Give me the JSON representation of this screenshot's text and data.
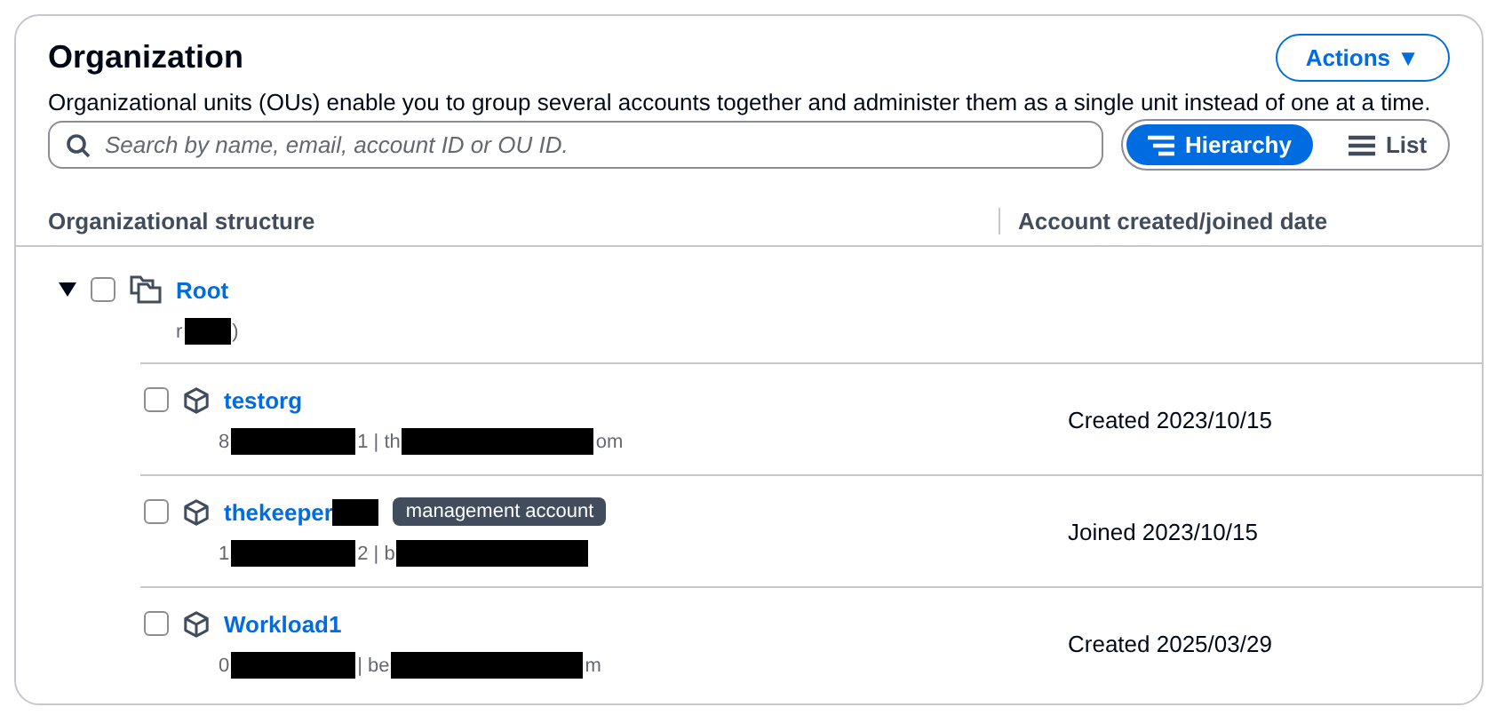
{
  "header": {
    "title": "Organization",
    "actions_button": "Actions ▼",
    "description": "Organizational units (OUs) enable you to group several accounts together and administer them as a single unit instead of one at a time."
  },
  "search": {
    "placeholder": "Search by name, email, account ID or OU ID."
  },
  "view_toggle": [
    {
      "label": "Hierarchy",
      "kind": "hierarchy",
      "selected": true
    },
    {
      "label": "List",
      "kind": "list",
      "selected": false
    }
  ],
  "table": {
    "columns": [
      "Organizational structure",
      "Account created/joined date"
    ],
    "tree": [
      {
        "name": "Root",
        "kind": "root",
        "expanded": true,
        "checked": false,
        "details": [
          {
            "kind": "text",
            "text": "r"
          },
          {
            "kind": "redacted"
          },
          {
            "kind": "text",
            "text": ")"
          }
        ],
        "children": [
          {
            "name": "testorg",
            "kind": "account",
            "checked": false,
            "date": "Created 2023/10/15",
            "details": [
              {
                "kind": "text",
                "text": "8"
              },
              {
                "kind": "redacted"
              },
              {
                "kind": "text",
                "text": "1 | th"
              },
              {
                "kind": "redacted"
              },
              {
                "kind": "text",
                "text": "om"
              }
            ]
          },
          {
            "name": "thekeeper",
            "kind": "account",
            "checked": false,
            "name_redacted": true,
            "badge": "management account",
            "date": "Joined 2023/10/15",
            "details": [
              {
                "kind": "text",
                "text": "1"
              },
              {
                "kind": "redacted"
              },
              {
                "kind": "text",
                "text": "2 | b"
              },
              {
                "kind": "redacted"
              }
            ]
          },
          {
            "name": "Workload1",
            "kind": "account",
            "checked": false,
            "date": "Created 2025/03/29",
            "details": [
              {
                "kind": "text",
                "text": "0"
              },
              {
                "kind": "redacted"
              },
              {
                "kind": "text",
                "text": "| be"
              },
              {
                "kind": "redacted"
              },
              {
                "kind": "text",
                "text": "m"
              }
            ]
          }
        ]
      }
    ]
  }
}
